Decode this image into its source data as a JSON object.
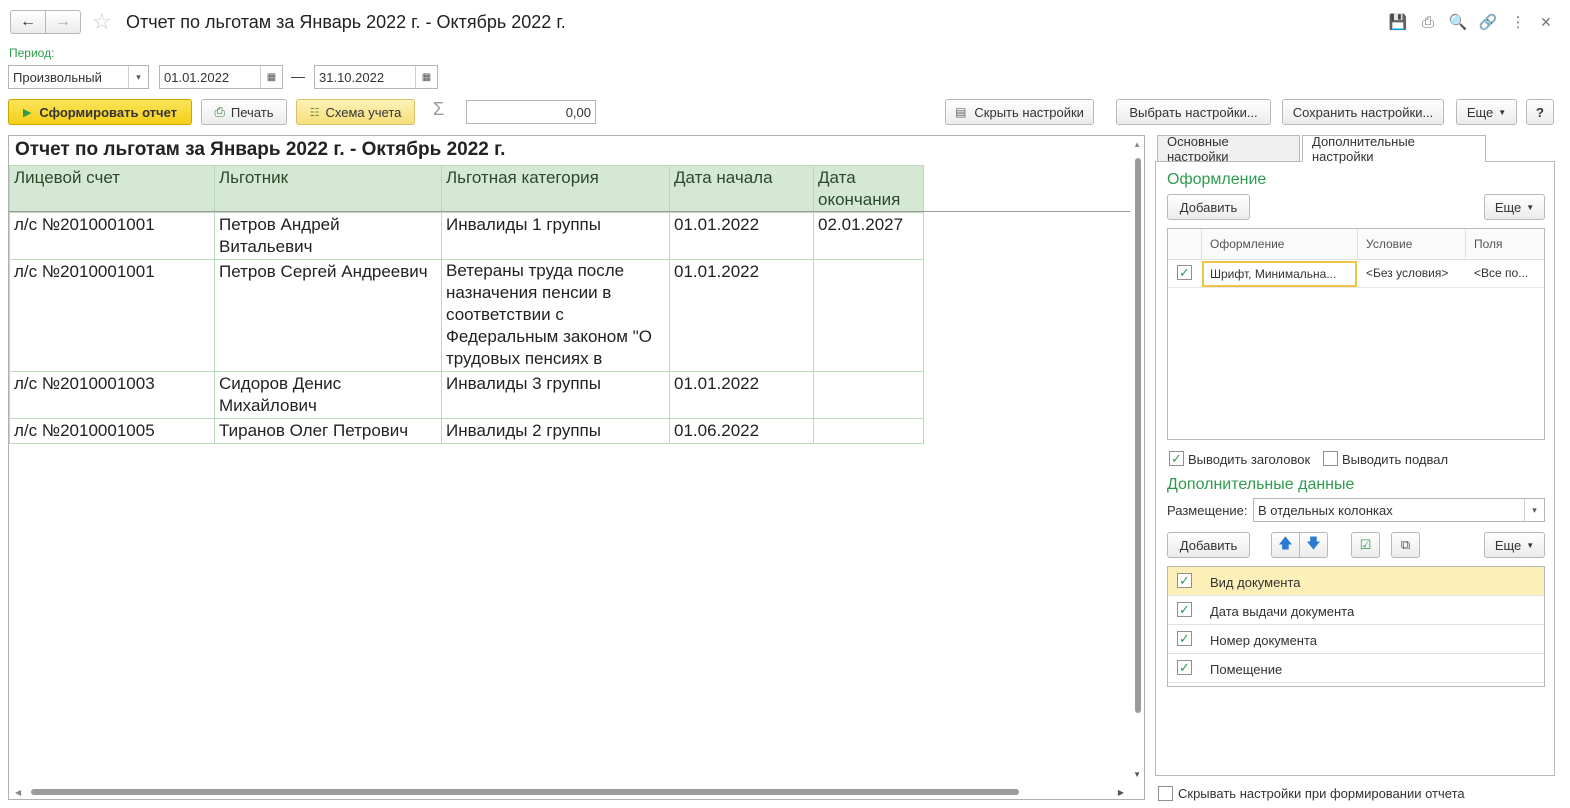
{
  "window": {
    "title": "Отчет по льготам за Январь 2022 г. - Октябрь 2022 г."
  },
  "period": {
    "label": "Период:",
    "type": "Произвольный",
    "from": "01.01.2022",
    "dash": "—",
    "to": "31.10.2022"
  },
  "toolbar": {
    "generate": "Сформировать отчет",
    "print": "Печать",
    "scheme": "Схема учета",
    "sigma": "Σ",
    "sum_value": "0,00",
    "hide_settings": "Скрыть настройки",
    "choose_settings": "Выбрать настройки...",
    "save_settings": "Сохранить настройки...",
    "more": "Еще",
    "help": "?"
  },
  "report": {
    "title": "Отчет по льготам за Январь 2022 г. - Октябрь 2022 г.",
    "columns": [
      "Лицевой счет",
      "Льготник",
      "Льготная категория",
      "Дата начала",
      "Дата окончания"
    ],
    "rows": [
      [
        "л/с №2010001001",
        "Петров Андрей Витальевич",
        "Инвалиды 1 группы",
        "01.01.2022",
        "02.01.2027"
      ],
      [
        "л/с №2010001001",
        "Петров Сергей Андреевич",
        "Ветераны труда после назначения  пенсии в соответствии с Федеральным законом \"О трудовых пенсиях в",
        "01.01.2022",
        ""
      ],
      [
        "л/с №2010001003",
        "Сидоров Денис Михайлович",
        "Инвалиды 3 группы",
        "01.01.2022",
        ""
      ],
      [
        "л/с №2010001005",
        "Тиранов Олег Петрович",
        "Инвалиды 2 группы",
        "01.06.2022",
        ""
      ]
    ]
  },
  "settings": {
    "tabs": [
      "Основные настройки",
      "Дополнительные настройки"
    ],
    "design_header": "Оформление",
    "add": "Добавить",
    "more": "Еще",
    "design_columns": [
      "Оформление",
      "Условие",
      "Поля"
    ],
    "design_rows": [
      {
        "format": "Шрифт, Минимальна...",
        "condition": "<Без условия>",
        "fields": "<Все по..."
      }
    ],
    "show_header": "Выводить заголовок",
    "show_footer": "Выводить подвал",
    "extra_header": "Дополнительные данные",
    "placement_label": "Размещение:",
    "placement_value": "В отдельных колонках",
    "extra_items": [
      "Вид документа",
      "Дата выдачи документа",
      "Номер документа",
      "Помещение"
    ],
    "hide_on_generate": "Скрывать настройки при формировании отчета"
  },
  "colors": {
    "header_bg": "#d5e8d4",
    "accent_green": "#2e9b4e",
    "generate_btn": "#f4cf17"
  }
}
